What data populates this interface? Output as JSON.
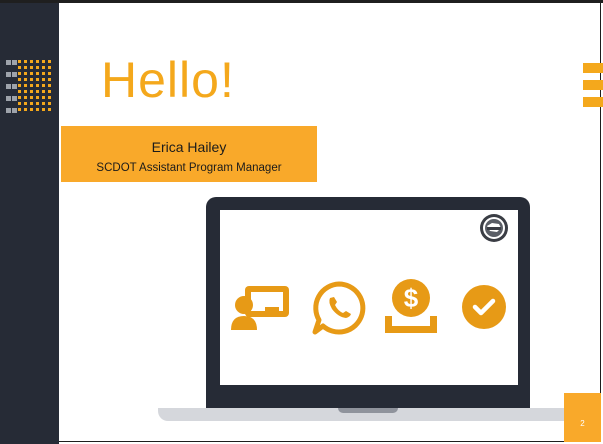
{
  "slide": {
    "title": "Hello!",
    "name": "Erica Hailey",
    "role": "SCDOT Assistant Program Manager",
    "page_number": "2"
  },
  "icons": [
    "presentation-user-icon",
    "whatsapp-icon",
    "dollar-hand-icon",
    "check-circle-icon",
    "scdot-seal-icon"
  ],
  "colors": {
    "accent": "#f4a81c",
    "name_box": "#f9a92a",
    "dark": "#262b36",
    "icon_orange": "#e79a16"
  }
}
